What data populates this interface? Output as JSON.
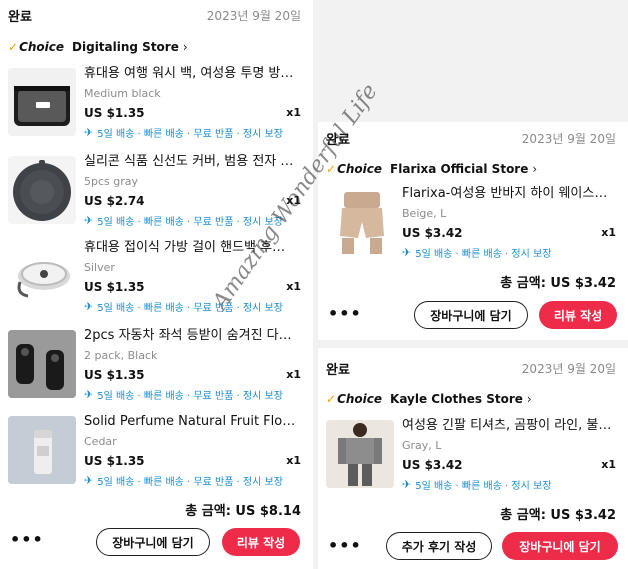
{
  "orders": [
    {
      "status": "완료",
      "date": "2023년 9월 20일",
      "choice_label": "Choice",
      "store": "Digitaling Store",
      "items": [
        {
          "title": "휴대용 여행 워시 백, 여성용 투명 방수...",
          "variant": "Medium black",
          "price": "US $1.35",
          "qty": "x1",
          "perks": "5일 배송 · 빠른 배송 · 무료 반품 · 정시 보장"
        },
        {
          "title": "실리콘 식품 신선도 커버, 범용 전자 레...",
          "variant": "5pcs gray",
          "price": "US $2.74",
          "qty": "x1",
          "perks": "5일 배송 · 빠른 배송 · 무료 반품 · 정시 보장"
        },
        {
          "title": "휴대용 접이식 가방 걸이 핸드백 후크 ...",
          "variant": "Silver",
          "price": "US $1.35",
          "qty": "x1",
          "perks": "5일 배송 · 빠른 배송 · 무료 반품 · 정시 보장"
        },
        {
          "title": "2pcs 자동차 좌석 등받이 숨겨진 다기...",
          "variant": "2 pack, Black",
          "price": "US $1.35",
          "qty": "x1",
          "perks": "5일 배송 · 빠른 배송 · 무료 반품 · 정시 보장"
        },
        {
          "title": "Solid Perfume Natural Fruit Flower...",
          "variant": "Cedar",
          "price": "US $1.35",
          "qty": "x1",
          "perks": "5일 배송 · 빠른 배송 · 무료 반품 · 정시 보장"
        }
      ],
      "total": "총 금액: US $8.14",
      "more": "•••",
      "buttons": [
        "장바구니에 담기",
        "리뷰 작성"
      ]
    },
    {
      "status": "완료",
      "date": "2023년 9월 20일",
      "choice_label": "Choice",
      "store": "Flarixa Official Store",
      "items": [
        {
          "title": "Flarixa-여성용 반바지 하이 웨이스트 ...",
          "variant": "Beige, L",
          "price": "US $3.42",
          "qty": "x1",
          "perks": "5일 배송 · 빠른 배송 · 정시 보장"
        }
      ],
      "total": "총 금액: US $3.42",
      "more": "•••",
      "buttons": [
        "장바구니에 담기",
        "리뷰 작성"
      ]
    },
    {
      "status": "완료",
      "date": "2023년 9월 20일",
      "choice_label": "Choice",
      "store": "Kayle Clothes Store",
      "items": [
        {
          "title": "여성용 긴팔 티셔츠, 곰팡이 라인, 불규...",
          "variant": "Gray, L",
          "price": "US $3.42",
          "qty": "x1",
          "perks": "5일 배송 · 빠른 배송 · 정시 보장"
        }
      ],
      "total": "총 금액: US $3.42",
      "more": "•••",
      "buttons": [
        "추가 후기 작성",
        "장바구니에 담기"
      ]
    }
  ],
  "watermark": "Amazing Wonderful Life",
  "icons": {
    "choice": "check-icon",
    "chevron": "chevron-right-icon",
    "shipping": "airplane-icon",
    "more": "more-dots-icon"
  },
  "colors": {
    "accent_red": "#ef2b4a",
    "perk_blue": "#1c8ccf",
    "choice_gold": "#f5a300"
  }
}
